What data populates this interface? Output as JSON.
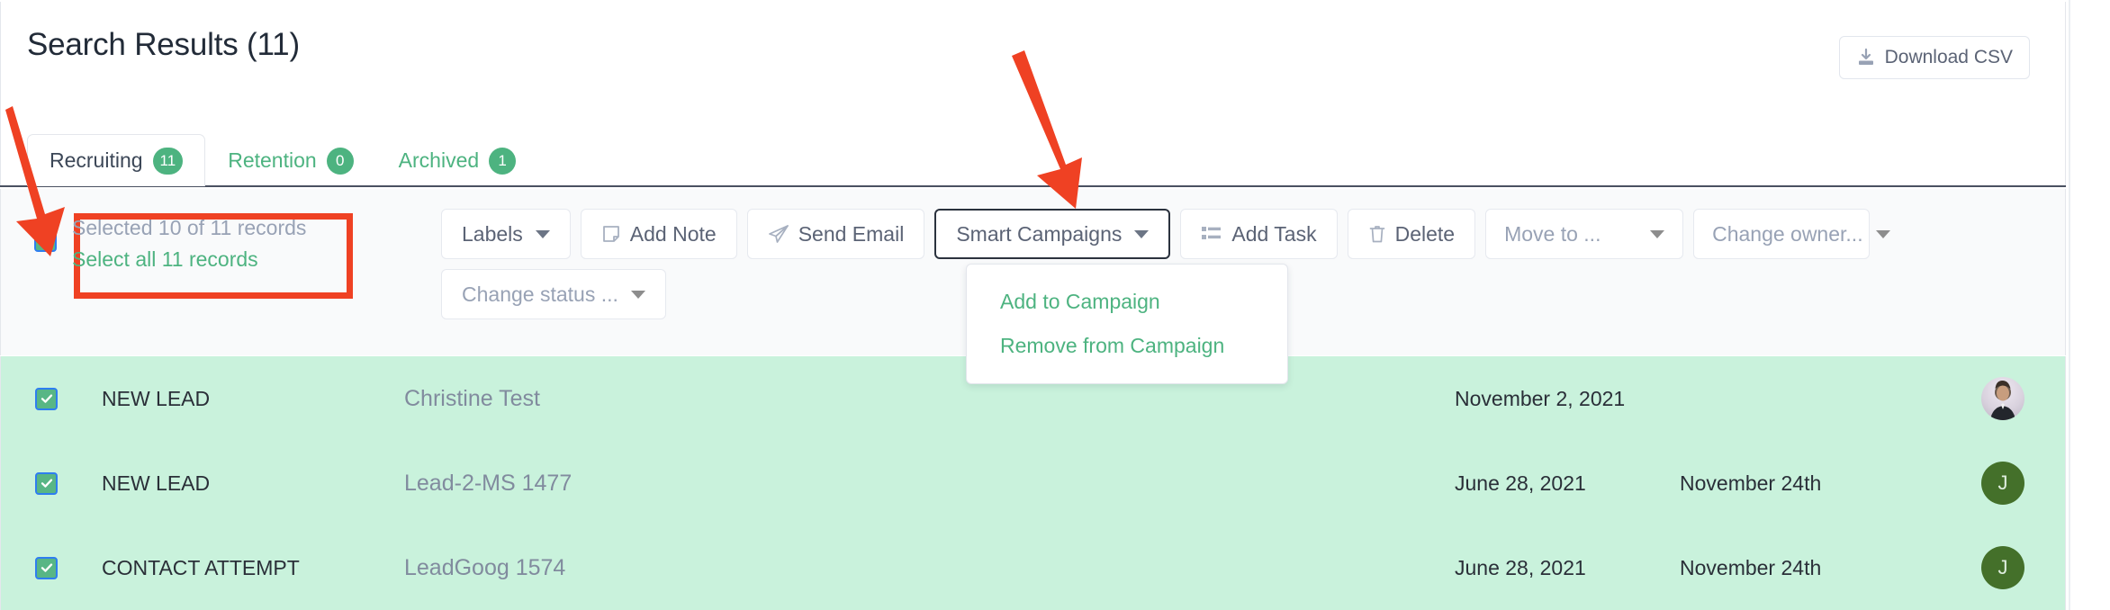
{
  "header": {
    "title": "Search Results (11)",
    "download_label": "Download CSV",
    "download_icon": "download-icon"
  },
  "tabs": [
    {
      "label": "Recruiting",
      "count": "11",
      "active": true
    },
    {
      "label": "Retention",
      "count": "0",
      "active": false
    },
    {
      "label": "Archived",
      "count": "1",
      "active": false
    }
  ],
  "selection": {
    "selected_text": "Selected 10 of 11 records",
    "select_all_text": "Select all 11 records",
    "checkbox_checked": true
  },
  "toolbar": {
    "labels": "Labels",
    "add_note": "Add Note",
    "send_email": "Send Email",
    "smart_campaigns": "Smart Campaigns",
    "add_task": "Add Task",
    "delete": "Delete",
    "move_to": "Move to ...",
    "change_owner": "Change owner...",
    "change_status": "Change status ..."
  },
  "dropdown": {
    "items": [
      "Add to Campaign",
      "Remove from Campaign"
    ]
  },
  "rows": [
    {
      "checked": true,
      "status": "NEW LEAD",
      "name": "Christine Test",
      "date1": "November 2, 2021",
      "date2": "",
      "avatar_type": "photo",
      "avatar_initial": ""
    },
    {
      "checked": true,
      "status": "NEW LEAD",
      "name": "Lead-2-MS 1477",
      "date1": "June 28, 2021",
      "date2": "November 24th",
      "avatar_type": "initial",
      "avatar_initial": "J"
    },
    {
      "checked": true,
      "status": "CONTACT ATTEMPT",
      "name": "LeadGoog 1574",
      "date1": "June 28, 2021",
      "date2": "November 24th",
      "avatar_type": "initial",
      "avatar_initial": "J"
    }
  ],
  "colors": {
    "accent_green": "#4db380",
    "row_highlight": "#c9f2dc",
    "annotation_red": "#ef4123",
    "checkbox_green": "#58b685",
    "checkbox_border_blue": "#2e7ef0",
    "text_dark": "#2a2f38",
    "text_muted": "#98a2b5"
  }
}
